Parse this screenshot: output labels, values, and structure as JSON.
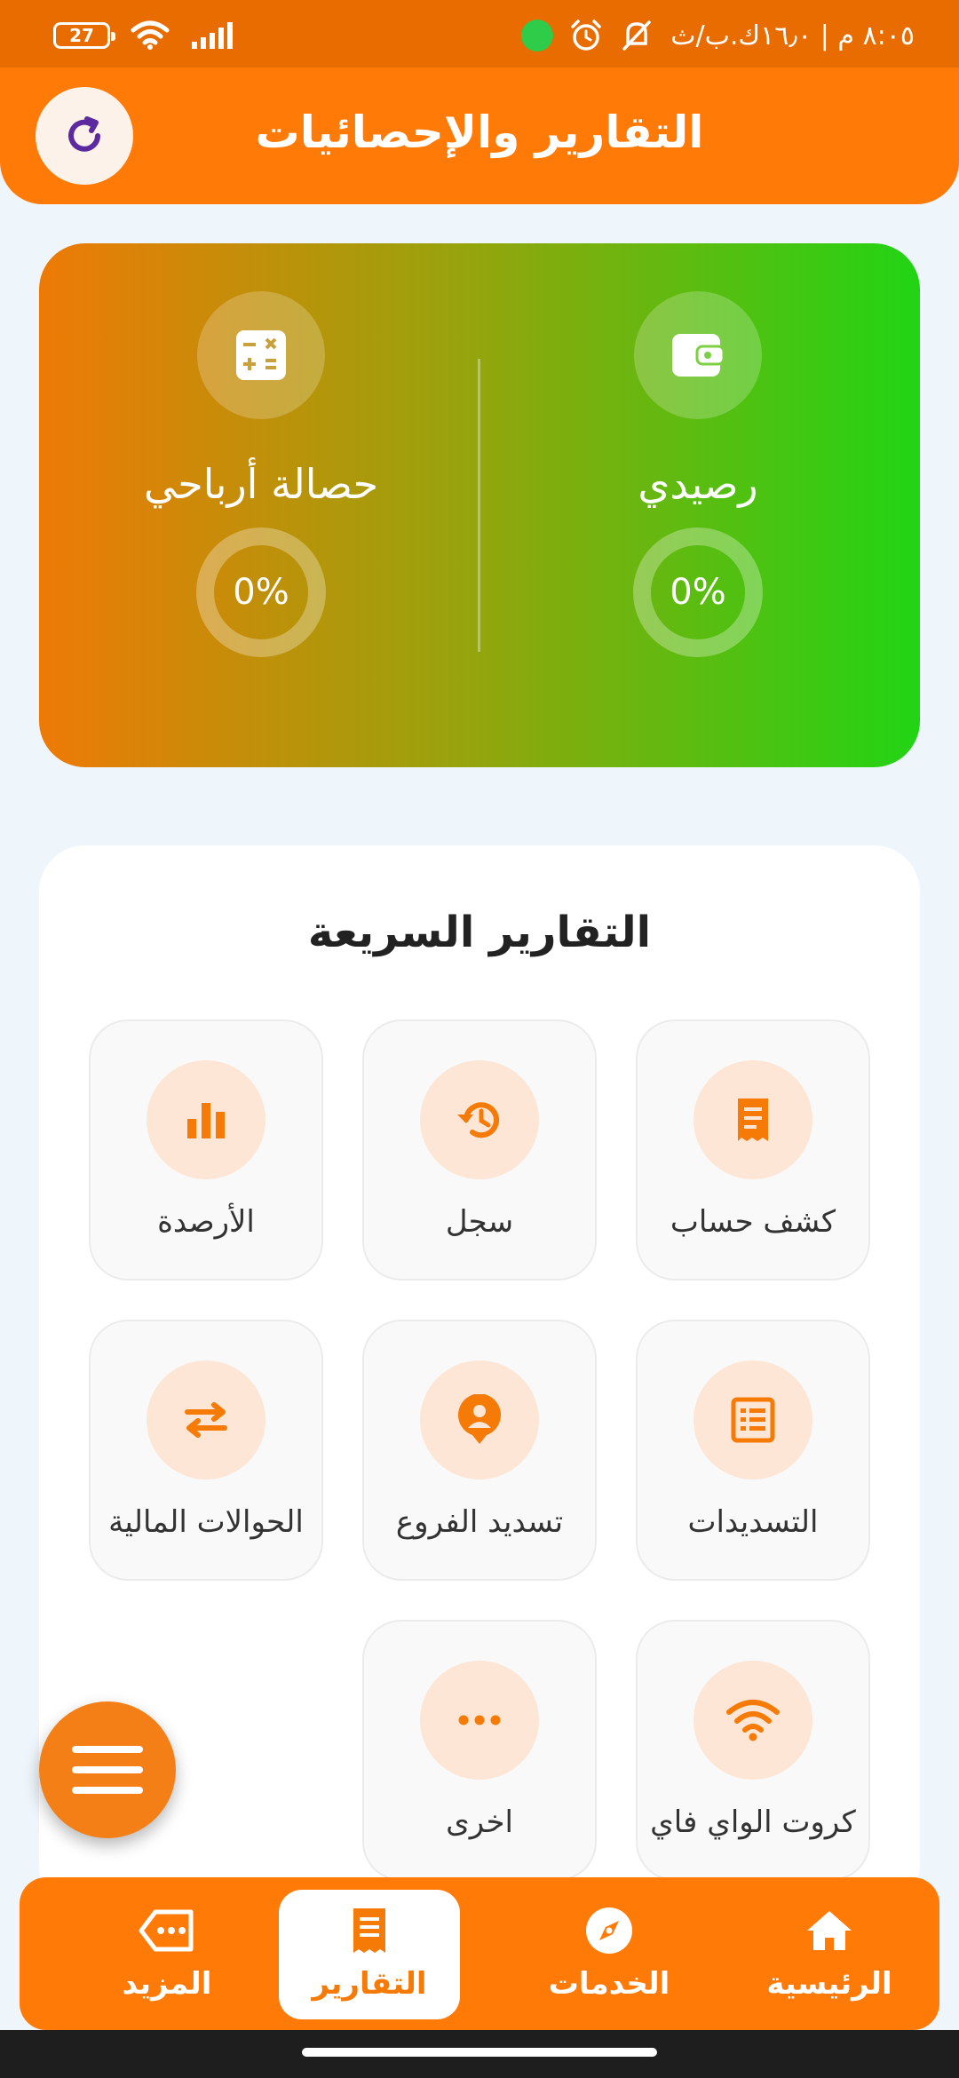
{
  "status_bar": {
    "time": "٨:٠٥ م | ١٦٫٠ك.ب/ث",
    "battery": "27"
  },
  "header": {
    "title": "التقارير والإحصائيات"
  },
  "stats": {
    "balance": {
      "label": "رصيدي",
      "value": "0%"
    },
    "profits": {
      "label": "حصالة أرباحي",
      "value": "0%"
    }
  },
  "quick_reports": {
    "title": "التقارير السريعة",
    "tiles": [
      {
        "label": "كشف حساب",
        "icon": "receipt-icon"
      },
      {
        "label": "سجل",
        "icon": "history-icon"
      },
      {
        "label": "الأرصدة",
        "icon": "bar-chart-icon"
      },
      {
        "label": "التسديدات",
        "icon": "list-document-icon"
      },
      {
        "label": "تسديد الفروع",
        "icon": "branch-person-icon"
      },
      {
        "label": "الحوالات المالية",
        "icon": "transfer-arrows-icon"
      },
      {
        "label": "كروت الواي فاي",
        "icon": "wifi-icon"
      },
      {
        "label": "اخرى",
        "icon": "more-dots-icon"
      }
    ]
  },
  "bottom_nav": {
    "items": [
      {
        "label": "الرئيسية",
        "icon": "home-icon"
      },
      {
        "label": "الخدمات",
        "icon": "compass-icon"
      },
      {
        "label": "التقارير",
        "icon": "report-icon"
      },
      {
        "label": "المزيد",
        "icon": "more-tag-icon"
      }
    ]
  },
  "colors": {
    "primary": "#ff7a07",
    "status_bar": "#e86c00",
    "accent_orange": "#f57a06",
    "green": "#22d414",
    "tile_icon_bg": "#fde6d6",
    "page_bg": "#eef6fb"
  }
}
